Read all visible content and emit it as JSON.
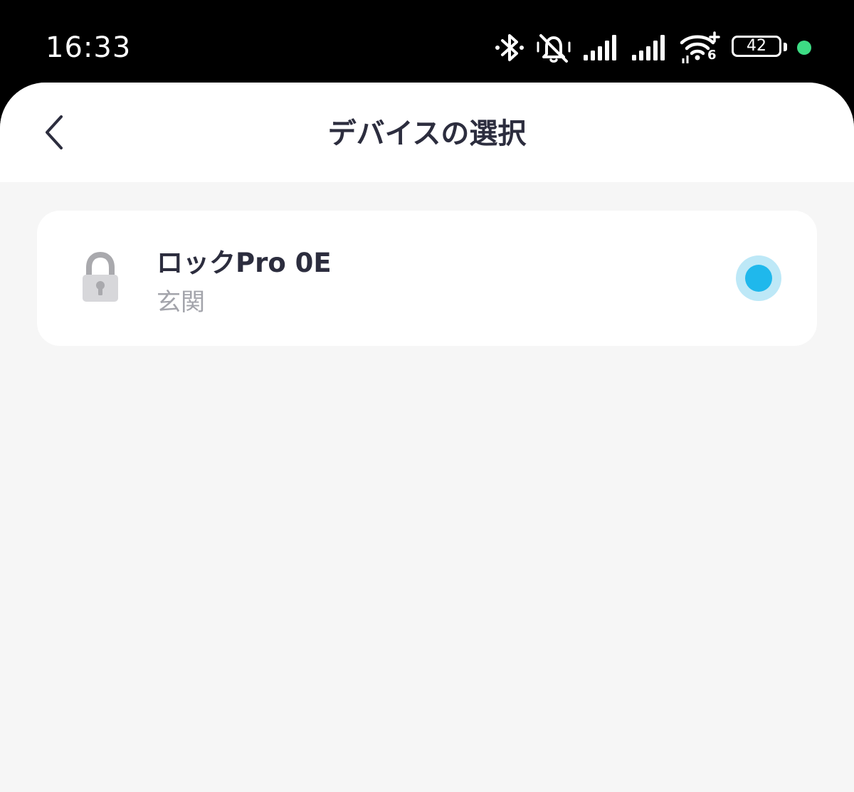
{
  "status_bar": {
    "time": "16:33",
    "battery_level": "42",
    "wifi_generation": "6",
    "icons": [
      "bluetooth-icon",
      "silent-mode-icon",
      "signal-strength-icon",
      "signal-strength-icon",
      "wifi-6-icon",
      "battery-icon",
      "active-indicator-dot"
    ],
    "indicator_color": "#3ddc84"
  },
  "header": {
    "title": "デバイスの選択",
    "back_icon": "chevron-left-icon"
  },
  "devices": [
    {
      "name": "ロックPro 0E",
      "location": "玄関",
      "icon": "lock-icon",
      "selected": true
    }
  ],
  "colors": {
    "accent": "#1fb8ec",
    "accent_halo": "#bde8f7",
    "title_text": "#2c2d3e",
    "secondary_text": "#a3a4ab",
    "background": "#f6f6f6"
  }
}
